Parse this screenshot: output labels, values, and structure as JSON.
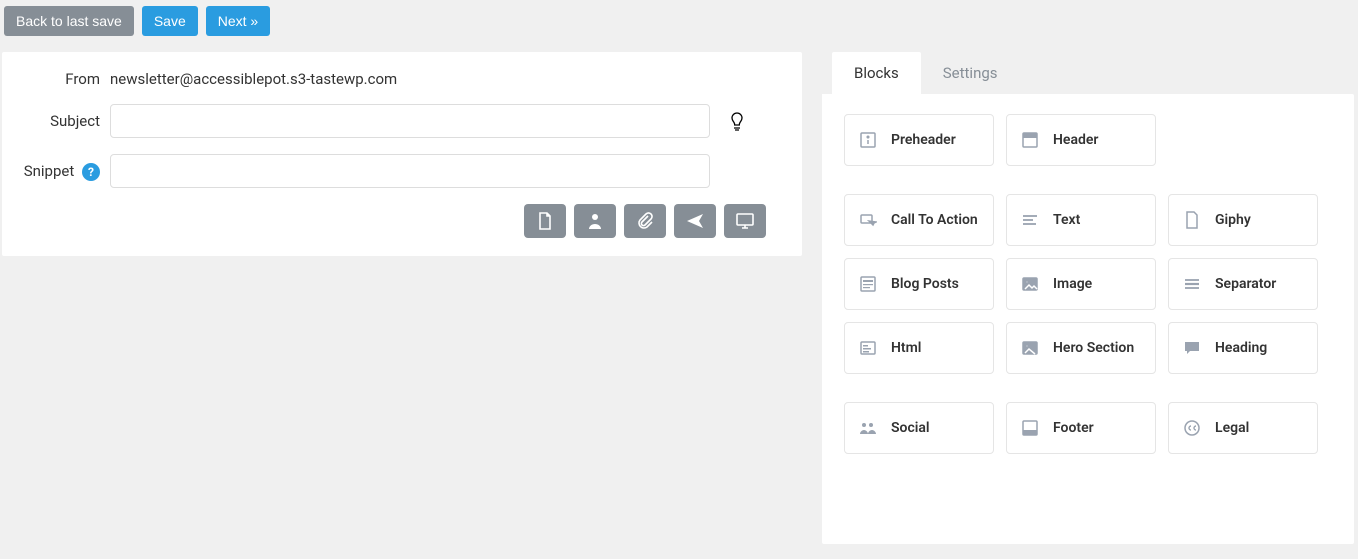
{
  "toolbar": {
    "back_label": "Back to last save",
    "save_label": "Save",
    "next_label": "Next »"
  },
  "form": {
    "from_label": "From",
    "from_value": "newsletter@accessiblepot.s3-tastewp.com",
    "subject_label": "Subject",
    "subject_value": "",
    "snippet_label": "Snippet",
    "snippet_value": ""
  },
  "tabs": {
    "blocks": "Blocks",
    "settings": "Settings"
  },
  "blocks": {
    "group1": [
      {
        "label": "Preheader",
        "icon": "info-box"
      },
      {
        "label": "Header",
        "icon": "layout-header"
      }
    ],
    "group2": [
      {
        "label": "Call To Action",
        "icon": "cursor"
      },
      {
        "label": "Text",
        "icon": "lines"
      },
      {
        "label": "Giphy",
        "icon": "file"
      },
      {
        "label": "Blog Posts",
        "icon": "post"
      },
      {
        "label": "Image",
        "icon": "image"
      },
      {
        "label": "Separator",
        "icon": "separator"
      },
      {
        "label": "Html",
        "icon": "code"
      },
      {
        "label": "Hero Section",
        "icon": "hero"
      },
      {
        "label": "Heading",
        "icon": "comment"
      }
    ],
    "group3": [
      {
        "label": "Social",
        "icon": "users"
      },
      {
        "label": "Footer",
        "icon": "layout-footer"
      },
      {
        "label": "Legal",
        "icon": "cc"
      }
    ]
  }
}
